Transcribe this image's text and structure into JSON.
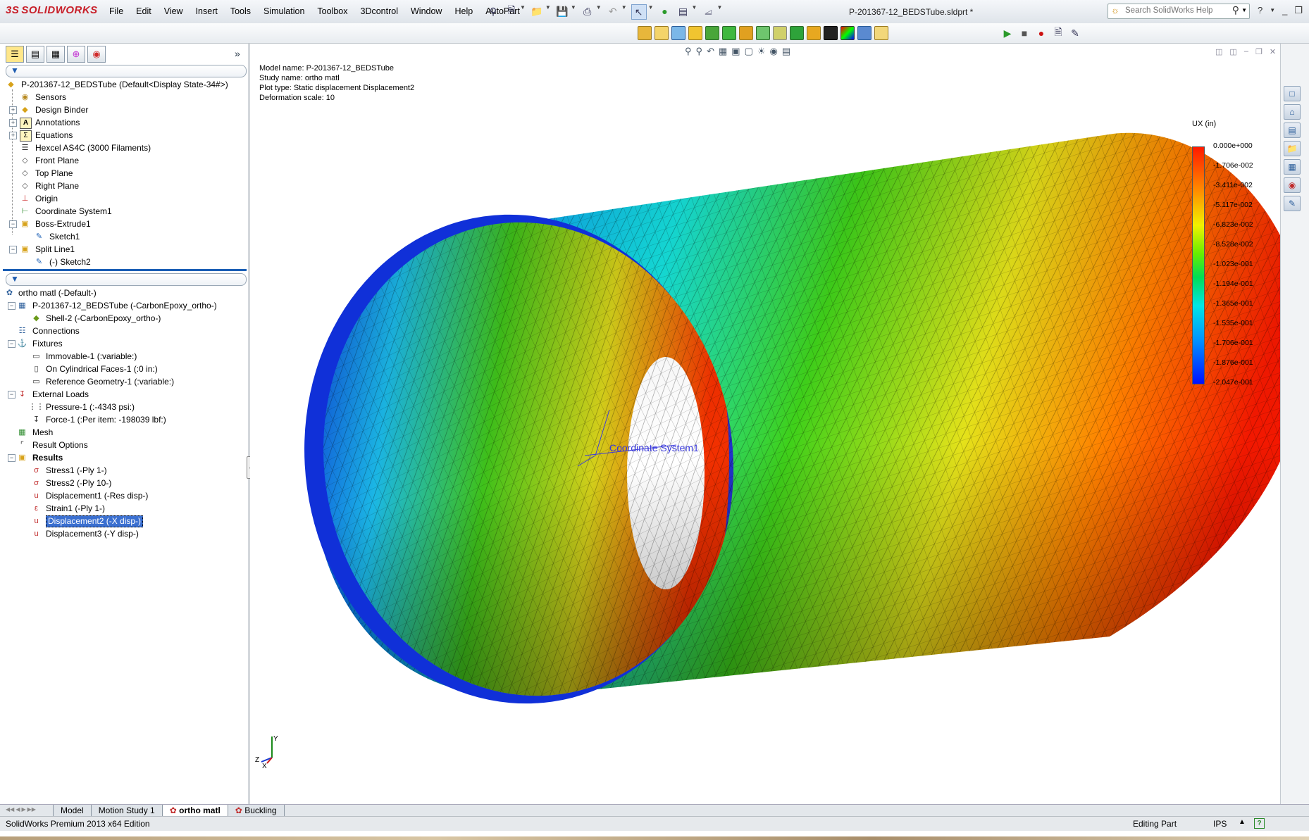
{
  "app": {
    "logo_prefix": "3S",
    "logo": "SOLIDWORKS",
    "document_title": "P-201367-12_BEDSTube.sldprt *"
  },
  "menu": [
    "File",
    "Edit",
    "View",
    "Insert",
    "Tools",
    "Simulation",
    "Toolbox",
    "3Dcontrol",
    "Window",
    "Help",
    "AutoPart"
  ],
  "search": {
    "placeholder": "Search SolidWorks Help"
  },
  "feature_tree": {
    "root": "P-201367-12_BEDSTube  (Default<Display State-34#>)",
    "items": [
      {
        "label": "Sensors"
      },
      {
        "label": "Design Binder"
      },
      {
        "label": "Annotations"
      },
      {
        "label": "Equations"
      },
      {
        "label": "Hexcel AS4C (3000 Filaments)"
      },
      {
        "label": "Front Plane"
      },
      {
        "label": "Top Plane"
      },
      {
        "label": "Right Plane"
      },
      {
        "label": "Origin"
      },
      {
        "label": "Coordinate System1"
      },
      {
        "label": "Boss-Extrude1"
      },
      {
        "label": "Sketch1"
      },
      {
        "label": "Split Line1"
      },
      {
        "label": "(-) Sketch2"
      }
    ]
  },
  "study_tree": {
    "root": "ortho matl (-Default-)",
    "items": [
      {
        "label": "P-201367-12_BEDSTube (-CarbonEpoxy_ortho-)"
      },
      {
        "label": "Shell-2 (-CarbonEpoxy_ortho-)"
      },
      {
        "label": "Connections"
      },
      {
        "label": "Fixtures"
      },
      {
        "label": "Immovable-1 (:variable:)"
      },
      {
        "label": "On Cylindrical Faces-1 (:0 in:)"
      },
      {
        "label": "Reference Geometry-1 (:variable:)"
      },
      {
        "label": "External Loads"
      },
      {
        "label": "Pressure-1 (:-4343 psi:)"
      },
      {
        "label": "Force-1 (:Per item: -198039 lbf:)"
      },
      {
        "label": "Mesh"
      },
      {
        "label": "Result Options"
      },
      {
        "label": "Results"
      },
      {
        "label": "Stress1 (-Ply 1-)"
      },
      {
        "label": "Stress2 (-Ply 10-)"
      },
      {
        "label": "Displacement1 (-Res disp-)"
      },
      {
        "label": "Strain1 (-Ply 1-)"
      },
      {
        "label": "Displacement2 (-X disp-)"
      },
      {
        "label": "Displacement3 (-Y disp-)"
      }
    ]
  },
  "viewport": {
    "info": {
      "model_name": "Model name: P-201367-12_BEDSTube",
      "study_name": "Study name: ortho matl",
      "plot_type": "Plot type: Static displacement Displacement2",
      "deformation": "Deformation scale: 10"
    },
    "legend": {
      "title": "UX (in)",
      "values": [
        "0.000e+000",
        "-1.706e-002",
        "-3.411e-002",
        "-5.117e-002",
        "-6.823e-002",
        "-8.528e-002",
        "-1.023e-001",
        "-1.194e-001",
        "-1.365e-001",
        "-1.535e-001",
        "-1.706e-001",
        "-1.876e-001",
        "-2.047e-001"
      ]
    },
    "coordinate_label": "Coordinate System1",
    "triad": {
      "x": "X",
      "y": "Y",
      "z": "Z"
    }
  },
  "bottom_tabs": [
    "Model",
    "Motion Study 1",
    "ortho matl",
    "Buckling"
  ],
  "status": {
    "edition": "SolidWorks Premium 2013 x64 Edition",
    "mode": "Editing Part",
    "units": "IPS",
    "help": "?"
  },
  "colors": {
    "selection": "#3a6fd0",
    "brand": "#c8202a",
    "legend_max": "#ff1a00",
    "legend_min": "#0010ff"
  }
}
